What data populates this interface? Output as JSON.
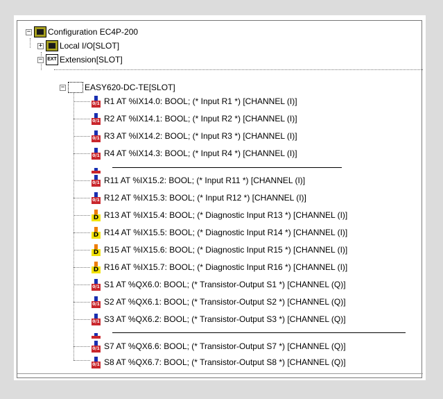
{
  "tree": {
    "root": {
      "label": "Configuration EC4P-200",
      "expander": "−",
      "icon": "configuration-icon"
    },
    "local_io": {
      "label": "Local I/O[SLOT]",
      "expander": "+",
      "icon": "module-icon"
    },
    "extension": {
      "label": "Extension[SLOT]",
      "expander": "−",
      "icon": "ext-icon",
      "icon_text": "EXT"
    },
    "easy": {
      "label": "EASY620-DC-TE[SLOT]",
      "expander": "−",
      "icon": "device-icon"
    },
    "channels": [
      {
        "label": "R1 AT %IX14.0: BOOL; (* Input R1 *) [CHANNEL (I)]",
        "kind": "input",
        "icon_text": "0/1"
      },
      {
        "label": "R2 AT %IX14.1: BOOL; (* Input R2 *) [CHANNEL (I)]",
        "kind": "input",
        "icon_text": "0/1"
      },
      {
        "label": "R3 AT %IX14.2: BOOL; (* Input R3 *) [CHANNEL (I)]",
        "kind": "input",
        "icon_text": "0/1"
      },
      {
        "label": "R4 AT %IX14.3: BOOL; (* Input R4 *) [CHANNEL (I)]",
        "kind": "input",
        "icon_text": "0/1"
      },
      {
        "label": "R11 AT %IX15.2: BOOL; (* Input R11 *) [CHANNEL (I)]",
        "kind": "input",
        "icon_text": "0/1"
      },
      {
        "label": "R12 AT %IX15.3: BOOL; (* Input R12 *) [CHANNEL (I)]",
        "kind": "input",
        "icon_text": "0/1"
      },
      {
        "label": "R13 AT %IX15.4: BOOL; (* Diagnostic Input R13 *) [CHANNEL (I)]",
        "kind": "diagnostic",
        "icon_text": "D"
      },
      {
        "label": "R14 AT %IX15.5: BOOL; (* Diagnostic Input R14 *) [CHANNEL (I)]",
        "kind": "diagnostic",
        "icon_text": "D"
      },
      {
        "label": "R15 AT %IX15.6: BOOL; (* Diagnostic Input R15 *) [CHANNEL (I)]",
        "kind": "diagnostic",
        "icon_text": "D"
      },
      {
        "label": "R16 AT %IX15.7: BOOL; (* Diagnostic Input R16 *) [CHANNEL (I)]",
        "kind": "diagnostic",
        "icon_text": "D"
      },
      {
        "label": "S1 AT %QX6.0: BOOL; (* Transistor-Output S1 *) [CHANNEL (Q)]",
        "kind": "output",
        "icon_text": "0/1"
      },
      {
        "label": "S2 AT %QX6.1: BOOL; (* Transistor-Output S2 *) [CHANNEL (Q)]",
        "kind": "output",
        "icon_text": "0/1"
      },
      {
        "label": "S3 AT %QX6.2: BOOL; (* Transistor-Output S3 *) [CHANNEL (Q)]",
        "kind": "output",
        "icon_text": "0/1"
      },
      {
        "label": "S7 AT %QX6.6: BOOL; (* Transistor-Output S7 *) [CHANNEL (Q)]",
        "kind": "output",
        "icon_text": "0/1"
      },
      {
        "label": "S8 AT %QX6.7: BOOL; (* Transistor-Output S8 *) [CHANNEL (Q)]",
        "kind": "output",
        "icon_text": "0/1"
      }
    ]
  },
  "colors": {
    "frame": "#dcdcdc",
    "input_top": "#1a2fb0",
    "input_bottom": "#c9262c",
    "diag_top": "#ef7d00",
    "diag_bottom": "#f2e20a",
    "config_icon": "#a7a020"
  }
}
